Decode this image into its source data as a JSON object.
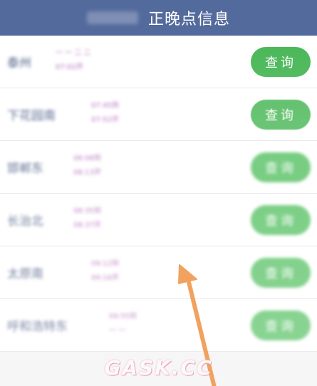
{
  "header": {
    "title": "正晚点信息"
  },
  "rows": [
    {
      "station": "泰州",
      "time1": "一 一 二 二",
      "time2": "07:02开",
      "button": "查询"
    },
    {
      "station": "下花园南",
      "time1": "07:45到",
      "time2": "07:52开",
      "button": "查询"
    },
    {
      "station": "邯郸东",
      "time1": "08:08到",
      "time2": "08:13开",
      "button": "查询"
    },
    {
      "station": "长治北",
      "time1": "08:35到",
      "time2": "08:37开",
      "button": "查询"
    },
    {
      "station": "太原南",
      "time1": "09:12到",
      "time2": "09:16开",
      "button": "查询"
    },
    {
      "station": "呼和浩特东",
      "time1": "09:55到",
      "time2": "一 一",
      "button": "查询"
    }
  ],
  "colors": {
    "header": "#536a9c",
    "button": "#4cb85a",
    "arrow": "#f0a25e",
    "time_text": "#b068b8"
  },
  "watermark": "GASK.CC"
}
